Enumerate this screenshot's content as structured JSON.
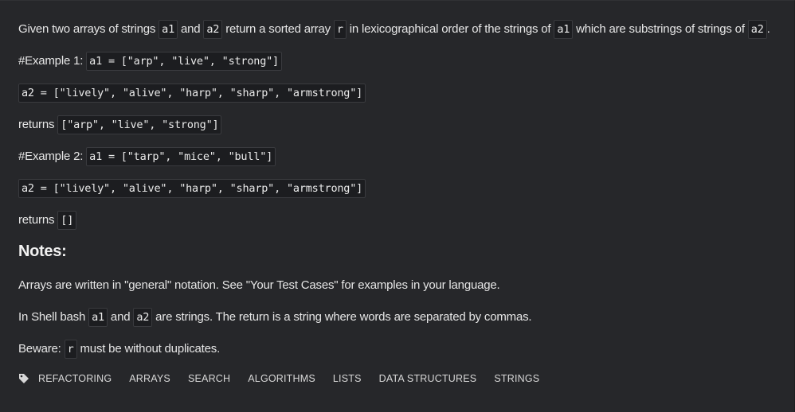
{
  "description": {
    "intro": {
      "t1": "Given two arrays of strings ",
      "c1": "a1",
      "t2": " and ",
      "c2": "a2",
      "t3": " return a sorted array ",
      "c3": "r",
      "t4": " in lexicographical order of the strings of ",
      "c4": "a1",
      "t5": " which are substrings of strings of ",
      "c5": "a2",
      "t6": "."
    },
    "example1": {
      "label": "#Example 1: ",
      "a1": "a1 = [\"arp\", \"live\", \"strong\"]",
      "a2": "a2 = [\"lively\", \"alive\", \"harp\", \"sharp\", \"armstrong\"]",
      "returns_label": "returns ",
      "returns": "[\"arp\", \"live\", \"strong\"]"
    },
    "example2": {
      "label": "#Example 2: ",
      "a1": "a1 = [\"tarp\", \"mice\", \"bull\"]",
      "a2": "a2 = [\"lively\", \"alive\", \"harp\", \"sharp\", \"armstrong\"]",
      "returns_label": "returns ",
      "returns": "[]"
    }
  },
  "notes": {
    "heading": "Notes:",
    "line1": "Arrays are written in \"general\" notation. See \"Your Test Cases\" for examples in your language.",
    "line2": {
      "t1": "In Shell bash ",
      "c1": "a1",
      "t2": " and ",
      "c2": "a2",
      "t3": " are strings. The return is a string where words are separated by commas."
    },
    "line3": {
      "t1": "Beware: ",
      "c1": "r",
      "t2": " must be without duplicates."
    }
  },
  "tags": [
    "REFACTORING",
    "ARRAYS",
    "SEARCH",
    "ALGORITHMS",
    "LISTS",
    "DATA STRUCTURES",
    "STRINGS"
  ],
  "tag_icon": "tag-icon"
}
